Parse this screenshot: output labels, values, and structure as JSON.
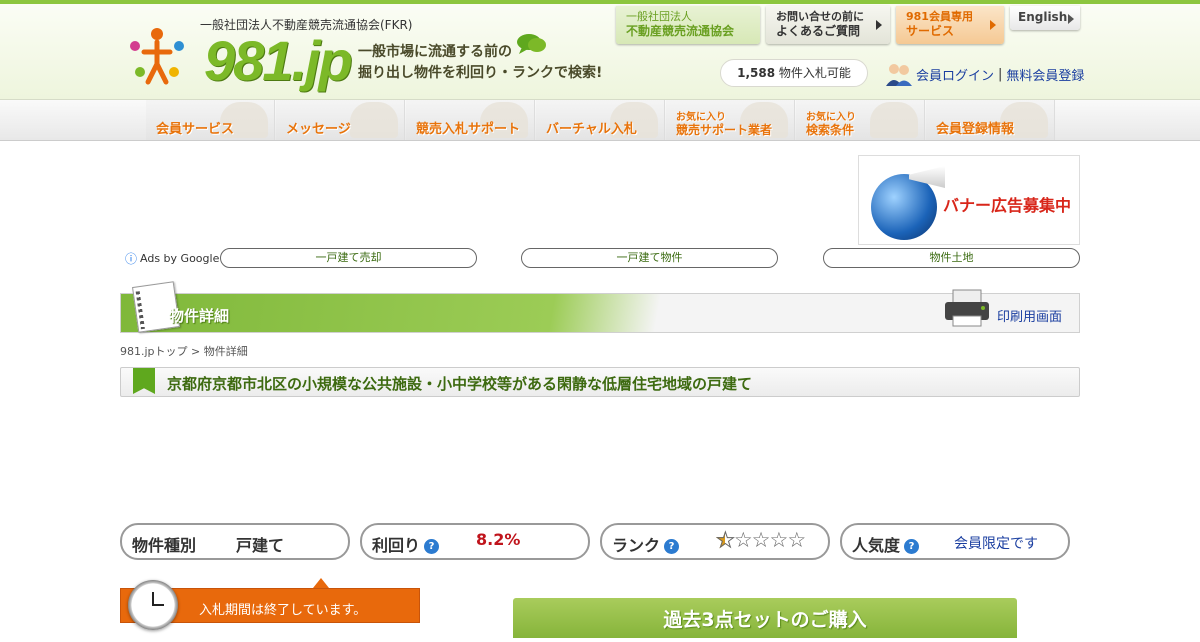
{
  "header": {
    "org_small": "一般社団法人不動産競売流通協会(FKR)",
    "logo_text": "981.jp",
    "tagline_line1": "一般市場に流通する前の",
    "tagline_line2": "掘り出し物件を利回り・ランクで検索!",
    "top_buttons": [
      {
        "line1": "一般社団法人",
        "line2": "不動産競売流通協会"
      },
      {
        "line1": "お問い合せの前に",
        "line2": "よくあるご質問"
      },
      {
        "line1": "981会員専用",
        "line2": "サービス"
      },
      {
        "line1": "English",
        "line2": ""
      }
    ],
    "count_number": "1,588",
    "count_suffix": "物件入札可能",
    "login_label": "会員ログイン",
    "separator": "|",
    "register_label": "無料会員登録"
  },
  "nav": [
    {
      "label": "会員サービス",
      "sub": ""
    },
    {
      "label": "メッセージ",
      "sub": ""
    },
    {
      "label": "競売入札サポート",
      "sub": ""
    },
    {
      "label": "バーチャル入札",
      "sub": ""
    },
    {
      "label": "競売サポート業者",
      "sub": "お気に入り"
    },
    {
      "label": "検索条件",
      "sub": "お気に入り"
    },
    {
      "label": "会員登録情報",
      "sub": ""
    }
  ],
  "banner": {
    "text": "バナー広告募集中"
  },
  "ads": {
    "label": "Ads by Google",
    "links": [
      "一戸建て売却",
      "一戸建て物件",
      "物件土地"
    ]
  },
  "section": {
    "title": "物件詳細",
    "print_label": "印刷用画面"
  },
  "breadcrumb": "981.jpトップ > 物件詳細",
  "property_title": "京都府京都市北区の小規模な公共施設・小中学校等がある閑静な低層住宅地域の戸建て",
  "stats": {
    "type_label": "物件種別",
    "type_value": "戸建て",
    "yield_label": "利回り",
    "yield_value": "8.2%",
    "rank_label": "ランク",
    "rank_value": 0.5,
    "rank_max": 5,
    "popularity_label": "人気度",
    "popularity_value": "会員限定です",
    "help_glyph": "?"
  },
  "bid_notice": "入札期間は終了しています。",
  "buy_button": "過去3点セットのご購入",
  "colors": {
    "brand_green": "#7cb928",
    "accent_orange": "#e8690c",
    "link_blue": "#1a3ea0",
    "yield_red": "#c0141c"
  }
}
